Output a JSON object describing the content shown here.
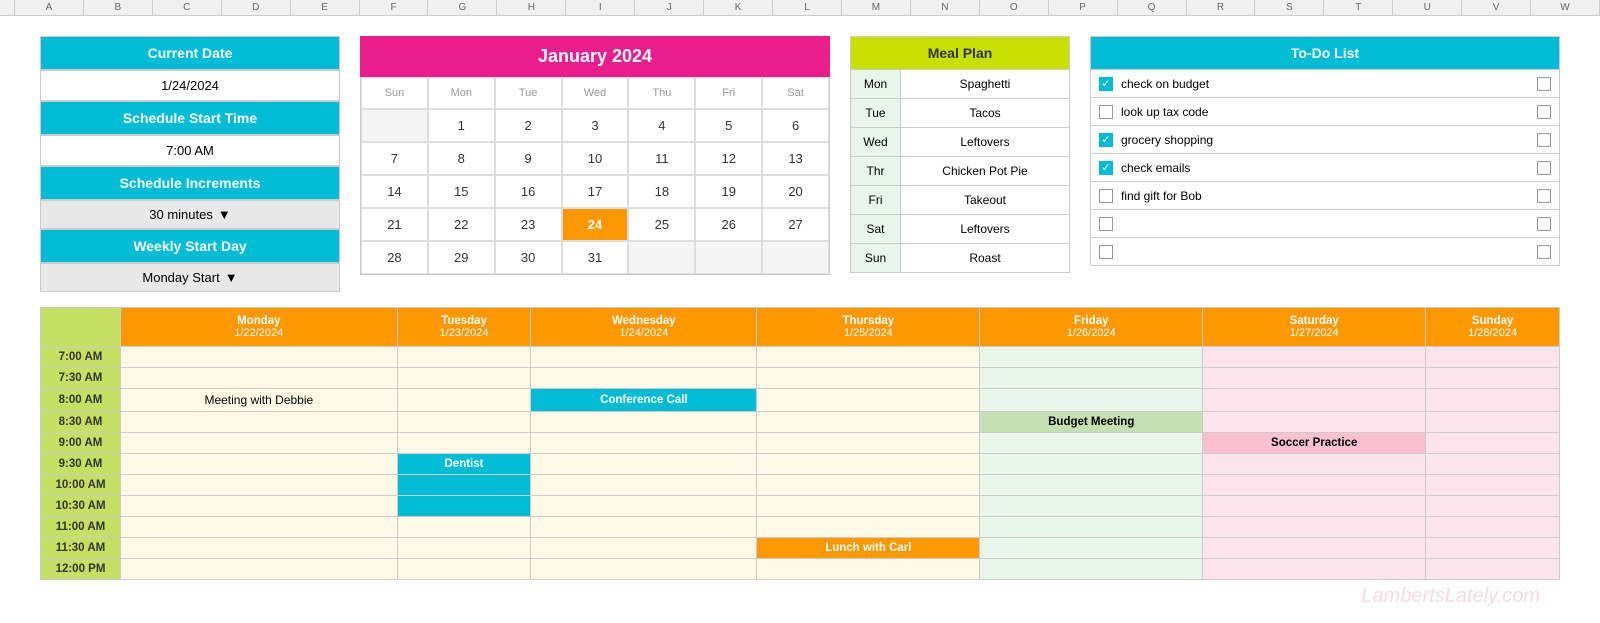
{
  "currentDate": {
    "label": "Current Date",
    "value": "1/24/2024"
  },
  "scheduleStartTime": {
    "label": "Schedule Start Time",
    "value": "7:00 AM"
  },
  "scheduleIncrements": {
    "label": "Schedule Increments",
    "value": "30 minutes"
  },
  "weeklyStartDay": {
    "label": "Weekly Start Day",
    "value": "Monday Start"
  },
  "calendar": {
    "title": "January 2024",
    "days": [
      "",
      "1",
      "2",
      "3",
      "4",
      "5",
      "6",
      "7",
      "8",
      "9",
      "10",
      "11",
      "12",
      "13",
      "14",
      "15",
      "16",
      "17",
      "18",
      "19",
      "20",
      "21",
      "22",
      "23",
      "24",
      "25",
      "26",
      "27",
      "28",
      "29",
      "30",
      "31",
      "",
      "",
      ""
    ],
    "today": "24"
  },
  "mealPlan": {
    "label": "Meal Plan",
    "items": [
      {
        "day": "Mon",
        "meal": "Spaghetti"
      },
      {
        "day": "Tue",
        "meal": "Tacos"
      },
      {
        "day": "Wed",
        "meal": "Leftovers"
      },
      {
        "day": "Thr",
        "meal": "Chicken Pot Pie"
      },
      {
        "day": "Fri",
        "meal": "Takeout"
      },
      {
        "day": "Sat",
        "meal": "Leftovers"
      },
      {
        "day": "Sun",
        "meal": "Roast"
      }
    ]
  },
  "todoList": {
    "label": "To-Do List",
    "items": [
      {
        "text": "check on budget",
        "checked": true,
        "hasRightBox": true
      },
      {
        "text": "look up tax code",
        "checked": false,
        "hasRightBox": true
      },
      {
        "text": "grocery shopping",
        "checked": true,
        "hasRightBox": true
      },
      {
        "text": "check emails",
        "checked": true,
        "hasRightBox": true
      },
      {
        "text": "find gift for Bob",
        "checked": false,
        "hasRightBox": true
      },
      {
        "text": "",
        "checked": false,
        "hasRightBox": true
      },
      {
        "text": "",
        "checked": false,
        "hasRightBox": true
      }
    ]
  },
  "schedule": {
    "days": [
      {
        "name": "Monday",
        "date": "1/22/2024"
      },
      {
        "name": "Tuesday",
        "date": "1/23/2024"
      },
      {
        "name": "Wednesday",
        "date": "1/24/2024"
      },
      {
        "name": "Thursday",
        "date": "1/25/2024"
      },
      {
        "name": "Friday",
        "date": "1/26/2024"
      },
      {
        "name": "Saturday",
        "date": "1/27/2024"
      },
      {
        "name": "Sunday",
        "date": "1/28/2024"
      }
    ],
    "times": [
      "7:00 AM",
      "7:30 AM",
      "8:00 AM",
      "8:30 AM",
      "9:00 AM",
      "9:30 AM",
      "10:00 AM",
      "10:30 AM",
      "11:00 AM",
      "11:30 AM",
      "12:00 PM"
    ],
    "events": {
      "8:00 AM_Monday": {
        "label": "Meeting with Debbie",
        "style": "plain"
      },
      "8:00 AM_Wednesday": {
        "label": "Conference Call",
        "style": "cyan"
      },
      "8:30 AM_Friday": {
        "label": "Budget Meeting",
        "style": "green"
      },
      "9:00 AM_Saturday": {
        "label": "Soccer Practice",
        "style": "pink"
      },
      "9:30 AM_Tuesday": {
        "label": "Dentist",
        "style": "cyan"
      },
      "10:00 AM_Tuesday": {
        "label": "",
        "style": "cyan"
      },
      "10:30 AM_Tuesday": {
        "label": "",
        "style": "cyan"
      },
      "11:30 AM_Thursday": {
        "label": "Lunch with Carl",
        "style": "orange"
      }
    }
  },
  "watermark": "LambertsLately.com"
}
